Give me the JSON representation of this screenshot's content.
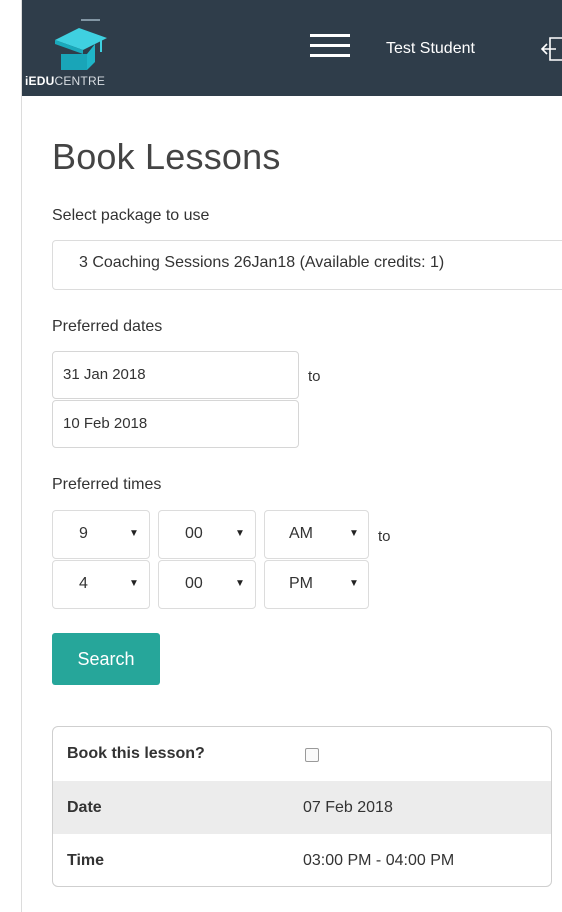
{
  "header": {
    "logo_bold": "iEDU",
    "logo_light": "CENTRE",
    "user_name": "Test Student",
    "menu_icon": "hamburger-menu-icon",
    "logout_icon": "logout-icon",
    "bg_color": "#2f3d4a"
  },
  "page": {
    "title": "Book Lessons"
  },
  "package": {
    "label": "Select package to use",
    "selected": "3 Coaching Sessions 26Jan18 (Available credits: 1)"
  },
  "dates": {
    "label": "Preferred dates",
    "from": "31 Jan 2018",
    "to_word": "to",
    "to": "10 Feb 2018"
  },
  "times": {
    "label": "Preferred times",
    "to_word": "to",
    "start": {
      "hour": "9",
      "minute": "00",
      "ampm": "AM"
    },
    "end": {
      "hour": "4",
      "minute": "00",
      "ampm": "PM"
    }
  },
  "search": {
    "label": "Search",
    "color": "#26a69a"
  },
  "result": {
    "book_label": "Book this lesson?",
    "book_checked": false,
    "date_label": "Date",
    "date_value": "07 Feb 2018",
    "time_label": "Time",
    "time_value": "03:00 PM - 04:00 PM"
  }
}
